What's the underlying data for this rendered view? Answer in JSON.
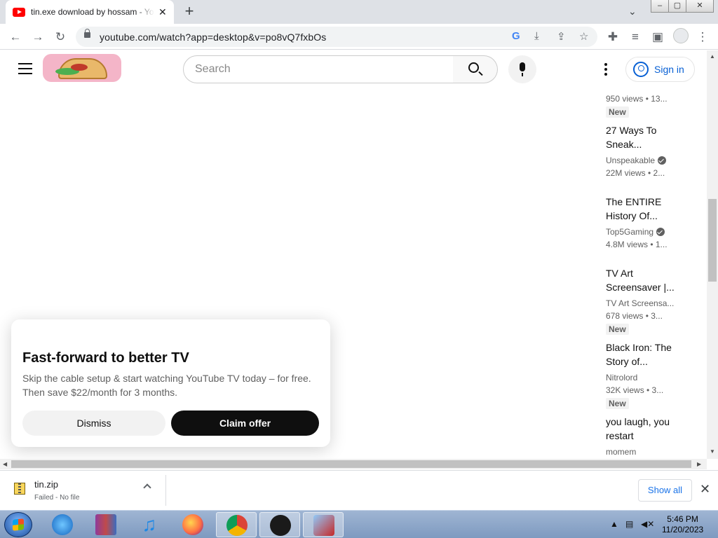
{
  "browser": {
    "tab_title": "tin.exe download by hossam - YouTube",
    "tab_close": "✕",
    "new_tab": "+",
    "tab_search": "⌄",
    "url": "youtube.com/watch?app=desktop&v=po8vQ7fxbOs",
    "win_min": "–",
    "win_max": "▢",
    "win_close": "✕"
  },
  "youtube": {
    "search_placeholder": "Search",
    "signin_label": "Sign in"
  },
  "recommendations": [
    {
      "meta": "950 views • 13...",
      "badge": "New"
    },
    {
      "title": "27 Ways To Sneak...",
      "channel": "Unspeakable",
      "verified": true,
      "meta": "22M views • 2..."
    },
    {
      "title": "The ENTIRE History Of...",
      "channel": "Top5Gaming",
      "verified": true,
      "meta": "4.8M views • 1..."
    },
    {
      "title": "TV Art Screensaver |...",
      "channel": "TV Art Screensa...",
      "meta": "678 views • 3...",
      "badge": "New"
    },
    {
      "title": "Black Iron: The Story of...",
      "channel": "Nitrolord",
      "meta": "32K views • 3...",
      "badge": "New"
    },
    {
      "title": "you laugh, you restart",
      "channel": "momem"
    }
  ],
  "promo": {
    "title": "Fast-forward to better TV",
    "body": "Skip the cable setup & start watching YouTube TV today – for free. Then save $22/month for 3 months.",
    "dismiss_label": "Dismiss",
    "claim_label": "Claim offer"
  },
  "download": {
    "filename": "tin.zip",
    "status": "Failed - No file",
    "show_all_label": "Show all",
    "close": "✕"
  },
  "taskbar": {
    "time": "5:46 PM",
    "date": "11/20/2023",
    "apps": [
      "internet-explorer",
      "winrar",
      "itunes",
      "firefox",
      "chrome",
      "app-black",
      "app-tools"
    ]
  },
  "colors": {
    "youtube_red": "#ff0000",
    "link_blue": "#065fd4",
    "chrome_blue": "#1a73e8"
  }
}
